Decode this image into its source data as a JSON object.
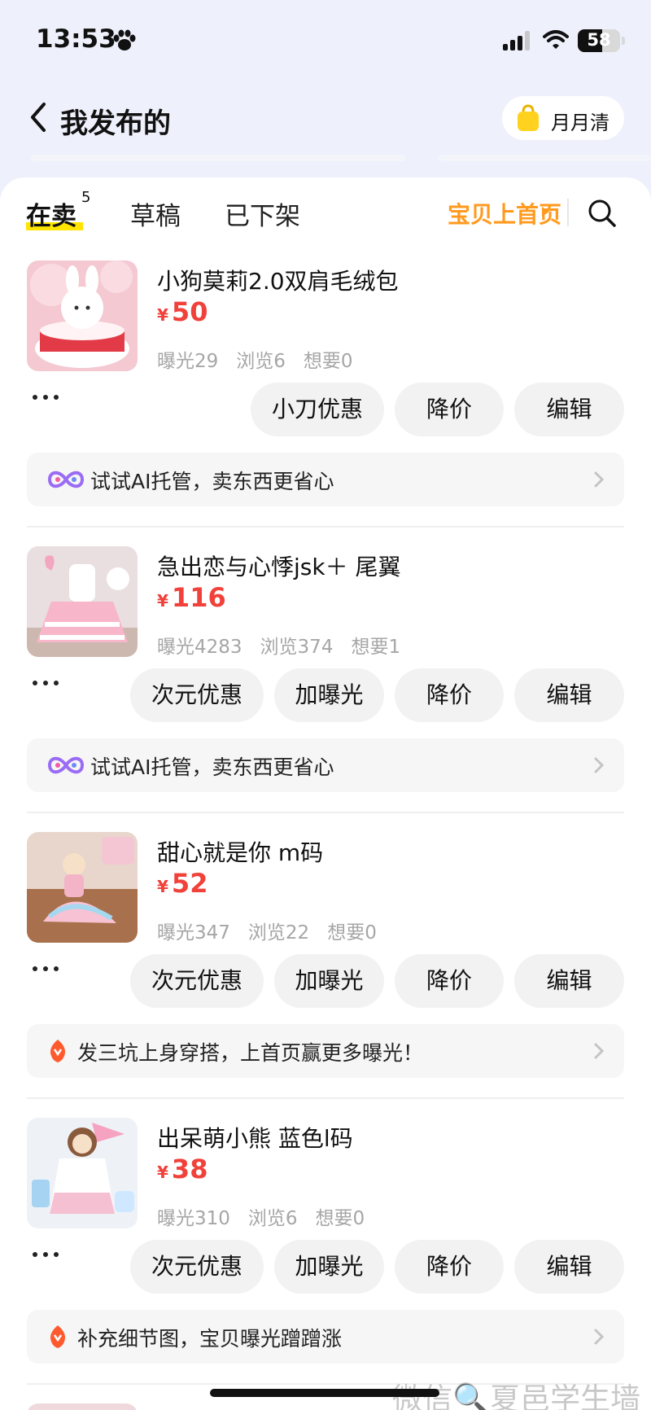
{
  "status_bar": {
    "time": "13:53",
    "battery": "58",
    "battery_level": 0.58
  },
  "nav": {
    "title": "我发布的",
    "monthly_label": "月月清"
  },
  "tabs": {
    "selling": "在卖",
    "selling_count": "5",
    "drafts": "草稿",
    "delisted": "已下架",
    "promo_link": "宝贝上首页"
  },
  "items": [
    {
      "title": "小狗莫莉2.0双肩毛绒包",
      "currency": "¥",
      "price": "50",
      "stats": {
        "exposure": "曝光29",
        "views": "浏览6",
        "wants": "想要0"
      },
      "buttons": [
        "小刀优惠",
        "降价",
        "编辑"
      ],
      "tip": "试试AI托管，卖东西更省心",
      "tip_icon": "ai-loop-icon"
    },
    {
      "title": "急出恋与心悸jsk＋ 尾翼",
      "currency": "¥",
      "price": "116",
      "stats": {
        "exposure": "曝光4283",
        "views": "浏览374",
        "wants": "想要1"
      },
      "buttons": [
        "次元优惠",
        "加曝光",
        "降价",
        "编辑"
      ],
      "tip": "试试AI托管，卖东西更省心",
      "tip_icon": "ai-loop-icon"
    },
    {
      "title": "甜心就是你 m码",
      "currency": "¥",
      "price": "52",
      "stats": {
        "exposure": "曝光347",
        "views": "浏览22",
        "wants": "想要0"
      },
      "buttons": [
        "次元优惠",
        "加曝光",
        "降价",
        "编辑"
      ],
      "tip": "发三坑上身穿搭，上首页赢更多曝光！",
      "tip_icon": "bulb-icon"
    },
    {
      "title": "出呆萌小熊 蓝色l码",
      "currency": "¥",
      "price": "38",
      "stats": {
        "exposure": "曝光310",
        "views": "浏览6",
        "wants": "想要0"
      },
      "buttons": [
        "次元优惠",
        "加曝光",
        "降价",
        "编辑"
      ],
      "tip": "补充细节图，宝贝曝光蹭蹭涨",
      "tip_icon": "bulb-icon"
    }
  ],
  "watermark": "微信🔍夏邑学生墙",
  "colors": {
    "price": "#f0413a",
    "promo": "#ff9a1f",
    "highlight": "#ffe400",
    "background": "#eef0fb"
  }
}
